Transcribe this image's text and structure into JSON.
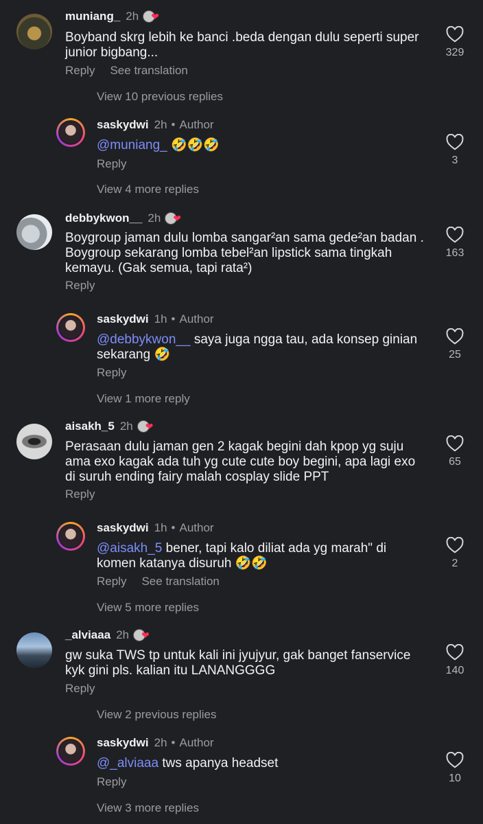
{
  "comments": [
    {
      "username": "muniang_",
      "time": "2h",
      "text": "Boyband skrg lebih ke banci .beda dengan dulu seperti super junior bigbang...",
      "reply": "Reply",
      "see_translation": "See translation",
      "likes": "329",
      "view_more": "View 10 previous replies",
      "author_reply": {
        "username": "saskydwi",
        "time": "2h",
        "author": "Author",
        "mention": "@muniang_",
        "text": " 🤣🤣🤣",
        "reply": "Reply",
        "likes": "3"
      },
      "after_reply": "View 4 more replies"
    },
    {
      "username": "debbykwon__",
      "time": "2h",
      "text": "Boygroup jaman dulu lomba sangar²an sama gede²an badan . Boygroup sekarang lomba tebel²an lipstick sama tingkah kemayu. (Gak semua, tapi rata²)",
      "reply": "Reply",
      "likes": "163",
      "author_reply": {
        "username": "saskydwi",
        "time": "1h",
        "author": "Author",
        "mention": "@debbykwon__",
        "text": " saya juga ngga tau, ada konsep ginian sekarang 🤣",
        "reply": "Reply",
        "likes": "25"
      },
      "after_reply": "View 1 more reply"
    },
    {
      "username": "aisakh_5",
      "time": "2h",
      "text": "Perasaan dulu jaman gen 2 kagak begini dah kpop yg suju ama exo kagak ada tuh yg cute cute boy begini, apa lagi exo di suruh ending fairy malah cosplay slide PPT",
      "reply": "Reply",
      "likes": "65",
      "author_reply": {
        "username": "saskydwi",
        "time": "1h",
        "author": "Author",
        "mention": "@aisakh_5",
        "text": " bener, tapi kalo diliat ada yg marah\" di komen katanya disuruh 🤣🤣",
        "reply": "Reply",
        "see_translation": "See translation",
        "likes": "2"
      },
      "after_reply": "View 5 more replies"
    },
    {
      "username": "_alviaaa",
      "time": "2h",
      "text": "gw suka TWS tp untuk kali ini jyujyur, gak banget fanservice kyk gini pls. kalian itu LANANGGGG",
      "reply": "Reply",
      "likes": "140",
      "view_more": "View 2 previous replies",
      "author_reply": {
        "username": "saskydwi",
        "time": "2h",
        "author": "Author",
        "mention": "@_alviaaa",
        "text": " tws apanya headset",
        "reply": "Reply",
        "likes": "10"
      },
      "after_reply": "View 3 more replies"
    }
  ],
  "colors": {
    "background": "#1e2024",
    "mention": "#7e8ef7",
    "secondary": "#9a9ca0",
    "heart": "#ff2d55"
  },
  "icons": {
    "like": "heart-outline-icon",
    "liked_by_author": "heart-badge-icon"
  }
}
